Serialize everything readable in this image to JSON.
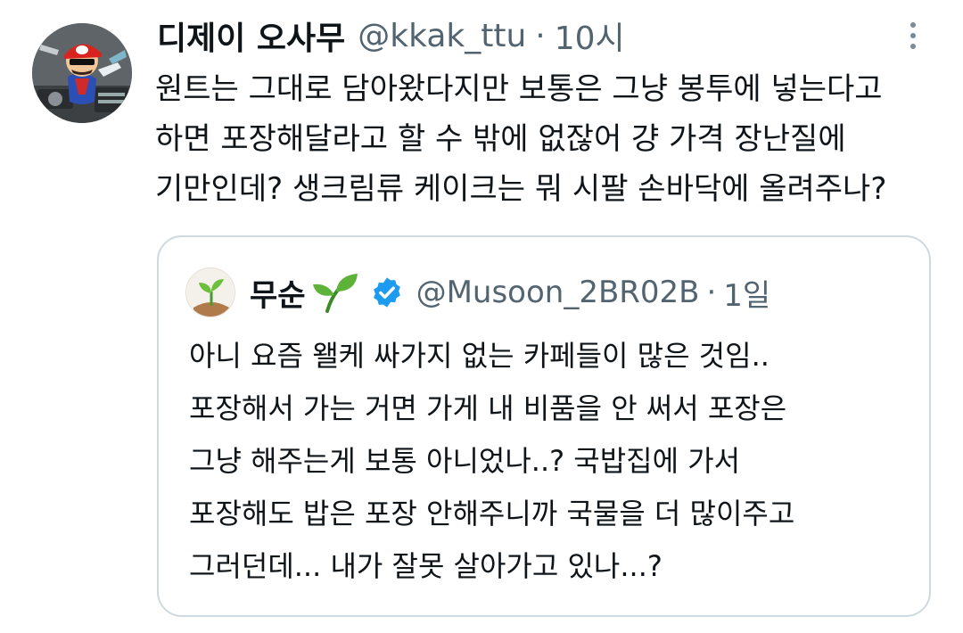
{
  "tweet": {
    "display_name": "디제이 오사무",
    "handle": "@kkak_ttu",
    "separator": "·",
    "time": "10시",
    "avatar_icon": "mario-dj-avatar",
    "more_icon": "more-vertical-icon",
    "text_lines": [
      "원트는 그대로 담아왔다지만 보통은 그냥 봉투에 넣는다고",
      "하면 포장해달라고 할 수 밖에 없잖어 걍 가격 장난질에",
      "기만인데? 생크림류 케이크는 뭐 시팔 손바닥에 올려주나?"
    ]
  },
  "quote": {
    "display_name": "무순",
    "name_emoji_icon": "seedling-icon",
    "verified_icon": "verified-badge-icon",
    "handle": "@Musoon_2BR02B",
    "separator": "·",
    "time": "1일",
    "avatar_icon": "seedling-avatar",
    "text_lines": [
      "아니 요즘 왤케 싸가지 없는 카페들이 많은 것임..",
      "포장해서 가는 거면 가게 내 비품을 안 써서 포장은",
      "그냥 해주는게 보통 아니었나..? 국밥집에 가서",
      "포장해도 밥은 포장 안해주니까 국물을 더 많이주고",
      "그러던데... 내가 잘못 살아가고 있나...?"
    ]
  },
  "colors": {
    "text_primary": "#0f1419",
    "text_secondary": "#536471",
    "border": "#cfd9de",
    "verified": "#1d9bf0",
    "sprout": "#3a9a2a"
  }
}
